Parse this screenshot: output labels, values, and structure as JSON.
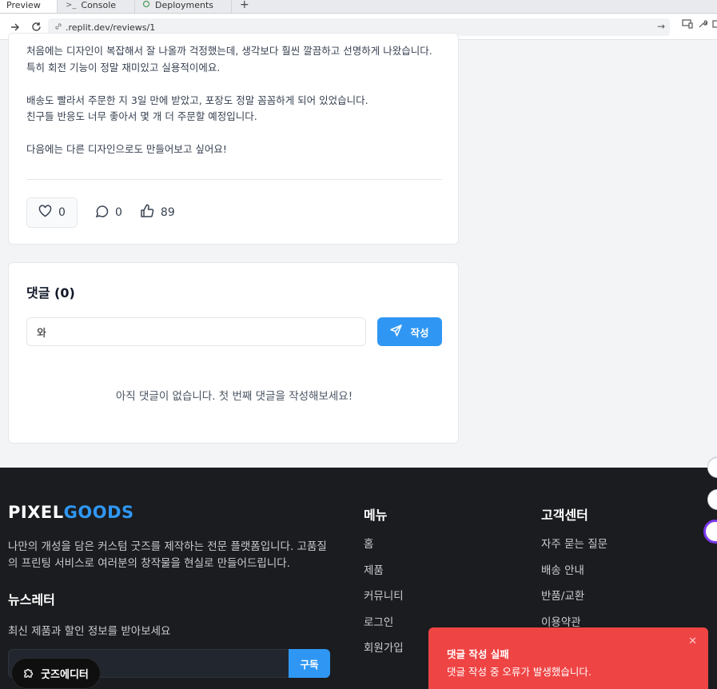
{
  "browser": {
    "tabs": [
      {
        "label": "Preview"
      },
      {
        "label": "Console",
        "icon": ">_"
      },
      {
        "label": "Deployments"
      }
    ],
    "new_tab": "+",
    "url": ".replit.dev/reviews/1"
  },
  "review": {
    "paragraphs": [
      [
        "처음에는 디자인이 복잡해서 잘 나올까 걱정했는데, 생각보다 훨씬 깔끔하고 선명하게 나왔습니다.",
        "특히 회전 기능이 정말 재미있고 실용적이에요."
      ],
      [
        "배송도 빨라서 주문한 지 3일 만에 받았고, 포장도 정말 꼼꼼하게 되어 있었습니다.",
        "친구들 반응도 너무 좋아서 몇 개 더 주문할 예정입니다."
      ],
      [
        "다음에는 다른 디자인으로도 만들어보고 싶어요!"
      ]
    ],
    "likes": "0",
    "comments": "0",
    "thumbs": "89"
  },
  "comments": {
    "title": "댓글 (0)",
    "input_value": "와",
    "submit_label": "작성",
    "empty_message": "아직 댓글이 없습니다. 첫 번째 댓글을 작성해보세요!"
  },
  "footer": {
    "brand_a": "PIXEL",
    "brand_b": "GOODS",
    "description": "나만의 개성을 담은 커스텀 굿즈를 제작하는 전문 플랫폼입니다. 고품질의 프린팅 서비스로 여러분의 창작물을 현실로 만들어드립니다.",
    "newsletter_title": "뉴스레터",
    "newsletter_sub": "최신 제품과 할인 정보를 받아보세요",
    "subscribe_label": "구독",
    "menu_title": "메뉴",
    "menu_items": [
      "홈",
      "제품",
      "커뮤니티",
      "로그인",
      "회원가입"
    ],
    "cs_title": "고객센터",
    "cs_items": [
      "자주 묻는 질문",
      "배송 안내",
      "반품/교환",
      "이용약관"
    ]
  },
  "editor_button": "굿즈에디터",
  "toast": {
    "title": "댓글 작성 실패",
    "message": "댓글 작성 중 오류가 발생했습니다.",
    "color": "#ef4444"
  },
  "colors": {
    "accent": "#2f97f3",
    "footer_bg": "#1b1c1f"
  }
}
